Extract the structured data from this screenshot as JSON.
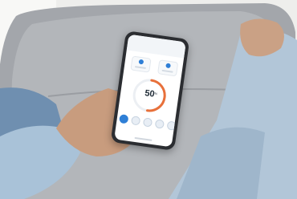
{
  "app": {
    "title": "",
    "gauge_value": "50",
    "gauge_unit": "%",
    "gauge_fill_fraction": 0.5
  },
  "colors": {
    "accent": "#2f7fd6",
    "gauge_ring": "#e8703a",
    "phone_body": "#2b2d31",
    "sofa": "#a8abb0",
    "sleeve": "#a9c2d8"
  }
}
